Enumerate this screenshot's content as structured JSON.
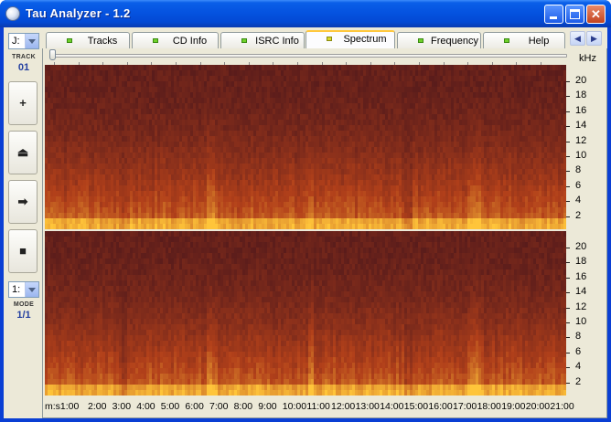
{
  "window": {
    "title": "Tau Analyzer - 1.2"
  },
  "left_panel": {
    "drive_combo": "J:",
    "track_label": "TRACK",
    "track_number": "01",
    "buttons": [
      {
        "name": "plus-button",
        "glyph": "+"
      },
      {
        "name": "eject-button",
        "glyph": "⏏"
      },
      {
        "name": "next-button",
        "glyph": "➡"
      },
      {
        "name": "stop-button",
        "glyph": "■"
      }
    ],
    "mode_combo": "1:",
    "mode_label": "MODE",
    "mode_value": "1/1"
  },
  "tabs": [
    {
      "label": "Tracks"
    },
    {
      "label": "CD Info"
    },
    {
      "label": "ISRC Info"
    },
    {
      "label": "Spectrum"
    },
    {
      "label": "Frequency"
    },
    {
      "label": "Help"
    }
  ],
  "active_tab": "Spectrum",
  "spectrum": {
    "freq_unit": "kHz",
    "freq_ticks": [
      "20",
      "18",
      "16",
      "14",
      "12",
      "10",
      "8",
      "6",
      "4",
      "2"
    ],
    "time_labels": [
      "m:s1:00",
      "2:00",
      "3:00",
      "4:00",
      "5:00",
      "6:00",
      "7:00",
      "8:00",
      "9:00",
      "10:00",
      "11:00",
      "12:00",
      "13:00",
      "14:00",
      "15:00",
      "16:00",
      "17:00",
      "18:00",
      "19:00",
      "20:00",
      "21:00"
    ],
    "colors": {
      "low": "#3a0f1c",
      "mid": "#b2401a",
      "high": "#ffc53a"
    }
  }
}
